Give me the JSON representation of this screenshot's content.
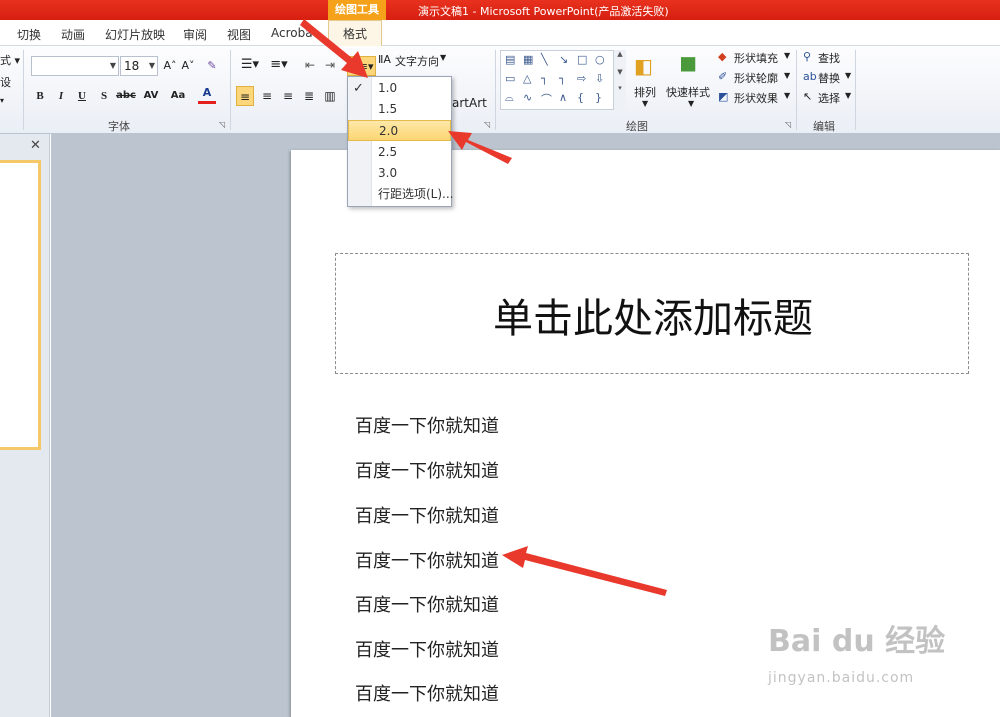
{
  "titlebar": {
    "tool_tab": "绘图工具",
    "title": "演示文稿1 - Microsoft PowerPoint(产品激活失败)"
  },
  "tabs": [
    "切换",
    "动画",
    "幻灯片放映",
    "审阅",
    "视图",
    "Acrobat",
    "格式"
  ],
  "ribbon": {
    "clipped_left": [
      "式 ▾",
      "设",
      "▾"
    ],
    "font_name": "",
    "font_size": "18",
    "grow_font": "A˄",
    "shrink_font": "A˅",
    "bold": "B",
    "italic": "I",
    "underline": "U",
    "shadow": "S",
    "strikethrough": "abc",
    "char_spacing": "AV",
    "change_case": "Aa",
    "font_color": "A",
    "text_direction": "文字方向",
    "smartart_partial": "artArt",
    "arrange": "排列",
    "quick_styles": "快速样式",
    "shape_fill": "形状填充",
    "shape_outline": "形状轮廓",
    "shape_effects": "形状效果",
    "find": "查找",
    "replace": "替换",
    "select": "选择",
    "group_font": "字体",
    "group_drawing": "绘图",
    "group_editing": "编辑"
  },
  "line_spacing_menu": {
    "items": [
      "1.0",
      "1.5",
      "2.0",
      "2.5",
      "3.0",
      "行距选项(L)..."
    ],
    "checked": "1.0",
    "highlighted": "2.0"
  },
  "slide": {
    "title_placeholder": "单击此处添加标题",
    "body_lines": [
      "百度一下你就知道",
      "百度一下你就知道",
      "百度一下你就知道",
      "百度一下你就知道",
      "百度一下你就知道",
      "百度一下你就知道",
      "百度一下你就知道"
    ]
  },
  "watermark": {
    "logo": "Bai du 经验",
    "url": "jingyan.baidu.com"
  },
  "colors": {
    "titlebar": "#d61f10",
    "tool_tab": "#f5a21a",
    "highlight": "#fbd673",
    "arrow": "#e8392c"
  }
}
